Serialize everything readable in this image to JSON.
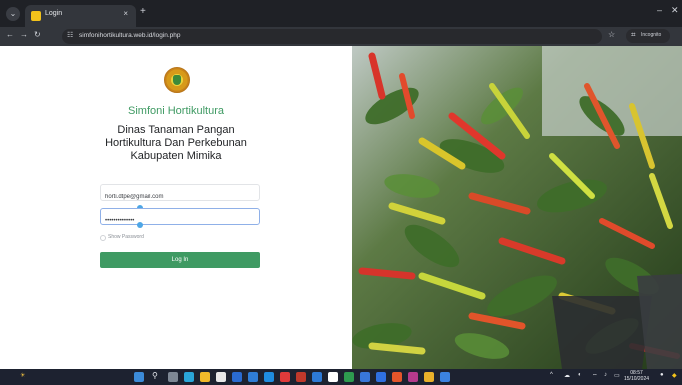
{
  "browser": {
    "tab": {
      "title": "Login",
      "close_glyph": "×"
    },
    "new_tab_glyph": "+",
    "window_controls": [
      "⌄",
      "✕"
    ],
    "address": {
      "url": "simfonihortikultura.web.id/login.php",
      "incognito_label": "Incognito"
    },
    "nav_icons": [
      "back-icon",
      "forward-icon",
      "reload-icon"
    ]
  },
  "login": {
    "app_name": "Simfoni Hortikultura",
    "agency_line1": "Dinas Tanaman Pangan",
    "agency_line2": "Hortikultura Dan Perkebunan",
    "agency_line3": "Kabupaten Mimika",
    "email_value": "horti.dtpe@gmail.com",
    "password_value": "••••••••••••••",
    "show_password_label": "Show Password",
    "button_label": "Log In"
  },
  "taskbar": {
    "time": "08:57",
    "date": "15/10/2024"
  },
  "colors": {
    "brand_green": "#3f9a63",
    "browser_dark": "#1f2126",
    "taskbar": "#1d2230"
  }
}
